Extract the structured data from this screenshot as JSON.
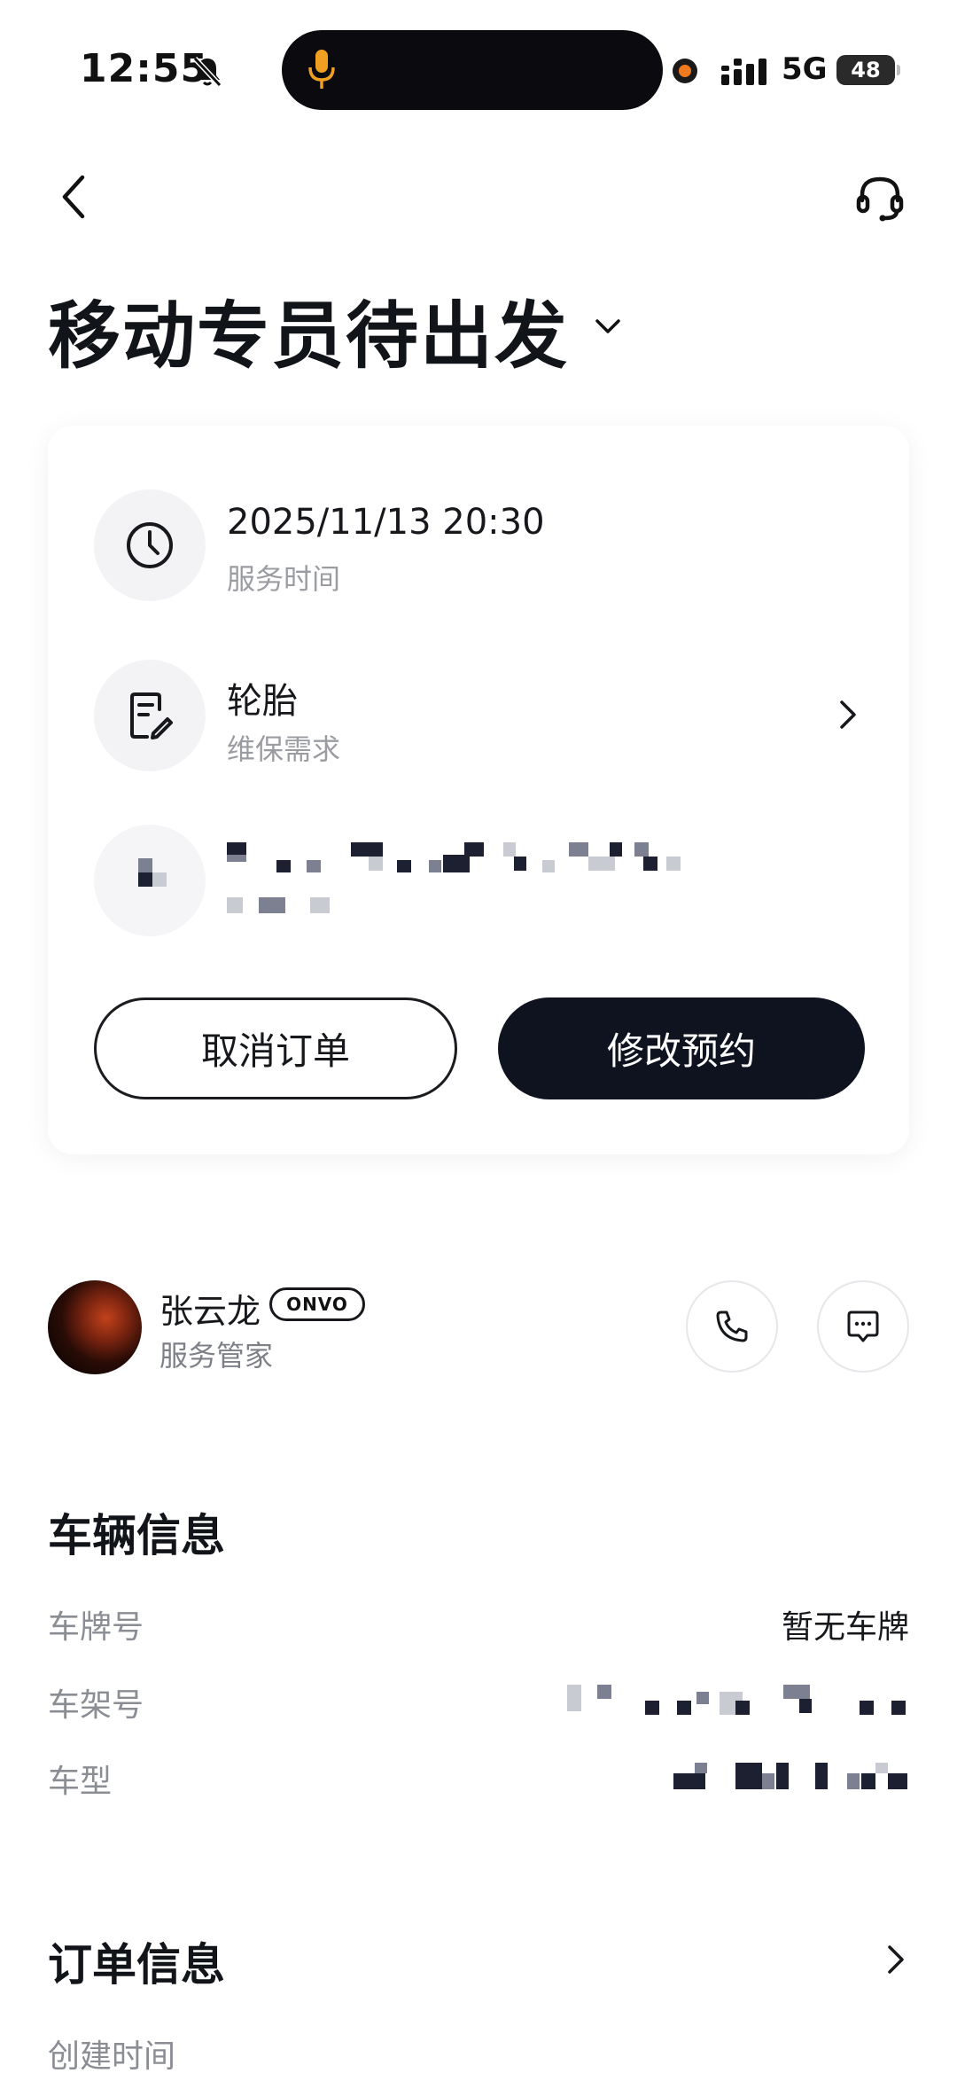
{
  "status_bar": {
    "time": "12:55",
    "network": "5G",
    "battery": "48",
    "icons": [
      "bell-muted-icon",
      "microphone-icon",
      "recording-dot-icon",
      "signal-icon"
    ]
  },
  "nav": {
    "back_icon": "chevron-left-icon",
    "support_icon": "headset-icon"
  },
  "title": "移动专员待出发",
  "card": {
    "service_time": {
      "value": "2025/11/13 20:30",
      "label": "服务时间",
      "icon": "clock-icon"
    },
    "maintenance": {
      "value": "轮胎",
      "label": "维保需求",
      "icon": "note-edit-icon"
    },
    "cancel_label": "取消订单",
    "modify_label": "修改预约"
  },
  "advisor": {
    "name": "张云龙",
    "brand": "ONVO",
    "role": "服务管家",
    "icons": [
      "phone-icon",
      "message-icon"
    ]
  },
  "vehicle": {
    "title": "车辆信息",
    "rows": [
      {
        "label": "车牌号",
        "value": "暂无车牌"
      },
      {
        "label": "车架号",
        "value": ""
      },
      {
        "label": "车型",
        "value": ""
      }
    ]
  },
  "order": {
    "title": "订单信息",
    "rows": [
      {
        "label": "创建时间",
        "value": ""
      }
    ]
  },
  "colors": {
    "primary_dark": "#0f1320",
    "muted_text": "#9a9ca2",
    "icon_bg": "#f3f3f5",
    "mic_accent": "#f0a020",
    "recording_accent": "#f07a1e"
  }
}
